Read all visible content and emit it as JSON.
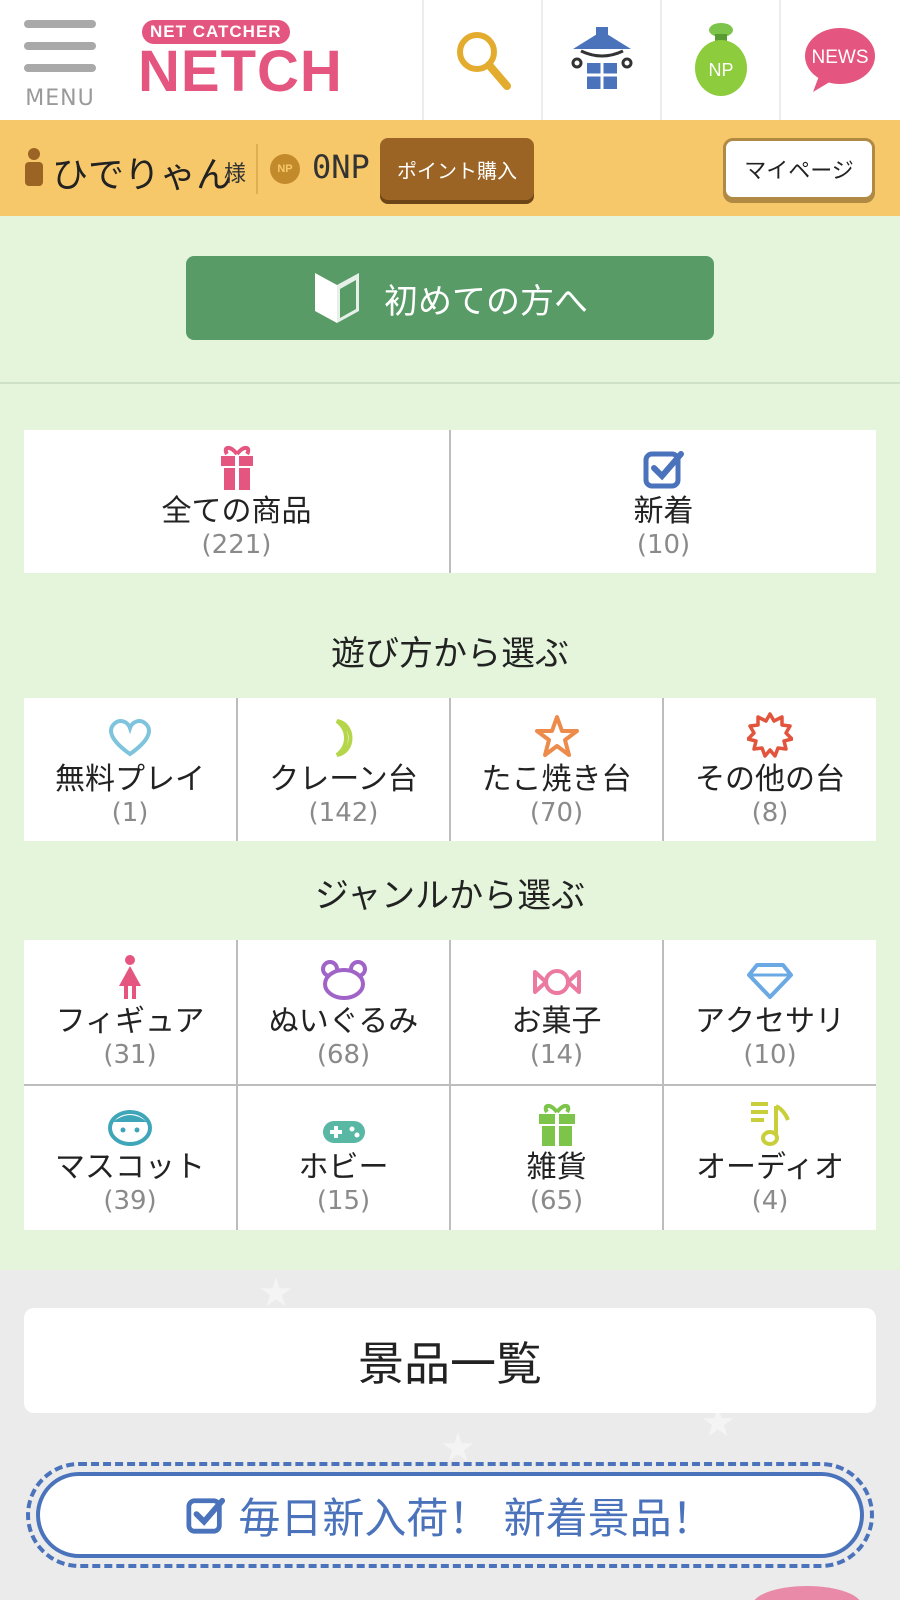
{
  "header": {
    "menu_label": "MENU",
    "logo_sub": "NET CATCHER",
    "logo_main": "NETCH",
    "icons": [
      "search-icon",
      "prize-house-icon",
      "np-bag-icon",
      "news-icon"
    ],
    "np_bag_label": "NP",
    "news_label": "NEWS"
  },
  "userbar": {
    "user_name": "ひでりゃん",
    "honorific": "様",
    "np_coin_label": "NP",
    "np_value": "0NP",
    "buy_points": "ポイント購入",
    "mypage": "マイページ"
  },
  "first_time_button": "初めての方へ",
  "top_categories": [
    {
      "label": "全ての商品",
      "count": "(221)",
      "icon": "gift-icon"
    },
    {
      "label": "新着",
      "count": "(10)",
      "icon": "checkbox-icon"
    }
  ],
  "play_section_title": "遊び方から選ぶ",
  "play_categories": [
    {
      "label": "無料プレイ",
      "count": "(1)",
      "icon": "heart-icon"
    },
    {
      "label": "クレーン台",
      "count": "(142)",
      "icon": "moon-icon"
    },
    {
      "label": "たこ焼き台",
      "count": "(70)",
      "icon": "star-icon"
    },
    {
      "label": "その他の台",
      "count": "(8)",
      "icon": "burst-icon"
    }
  ],
  "genre_section_title": "ジャンルから選ぶ",
  "genre_categories": [
    {
      "label": "フィギュア",
      "count": "(31)",
      "icon": "figure-icon"
    },
    {
      "label": "ぬいぐるみ",
      "count": "(68)",
      "icon": "bear-icon"
    },
    {
      "label": "お菓子",
      "count": "(14)",
      "icon": "candy-icon"
    },
    {
      "label": "アクセサリ",
      "count": "(10)",
      "icon": "diamond-icon"
    },
    {
      "label": "マスコット",
      "count": "(39)",
      "icon": "mascot-icon"
    },
    {
      "label": "ホビー",
      "count": "(15)",
      "icon": "gamepad-icon"
    },
    {
      "label": "雑貨",
      "count": "(65)",
      "icon": "gift-green-icon"
    },
    {
      "label": "オーディオ",
      "count": "(4)",
      "icon": "music-icon"
    }
  ],
  "prize_list_title": "景品一覧",
  "new_arrivals_banner": "毎日新入荷！ 新着景品！",
  "colors": {
    "brand_pink": "#e4567f",
    "userbar_yellow": "#f6c86a",
    "green_bg": "#e4f5dc",
    "green_button": "#589b67",
    "blue_accent": "#4b73bc"
  }
}
